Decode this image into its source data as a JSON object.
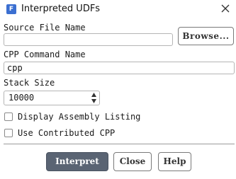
{
  "window": {
    "title": "Interpreted UDFs",
    "app_icon_letter": "F"
  },
  "source_file": {
    "label": "Source File Name",
    "value": "",
    "browse_label": "Browse..."
  },
  "cpp_command": {
    "label": "CPP Command Name",
    "value": "cpp"
  },
  "stack_size": {
    "label": "Stack Size",
    "value": "10000"
  },
  "options": [
    {
      "label": "Display Assembly Listing",
      "checked": false
    },
    {
      "label": "Use Contributed CPP",
      "checked": false
    }
  ],
  "buttons": {
    "interpret": "Interpret",
    "close": "Close",
    "help": "Help"
  },
  "colors": {
    "primary_button": "#5a6473",
    "app_icon": "#3b6fd1"
  }
}
